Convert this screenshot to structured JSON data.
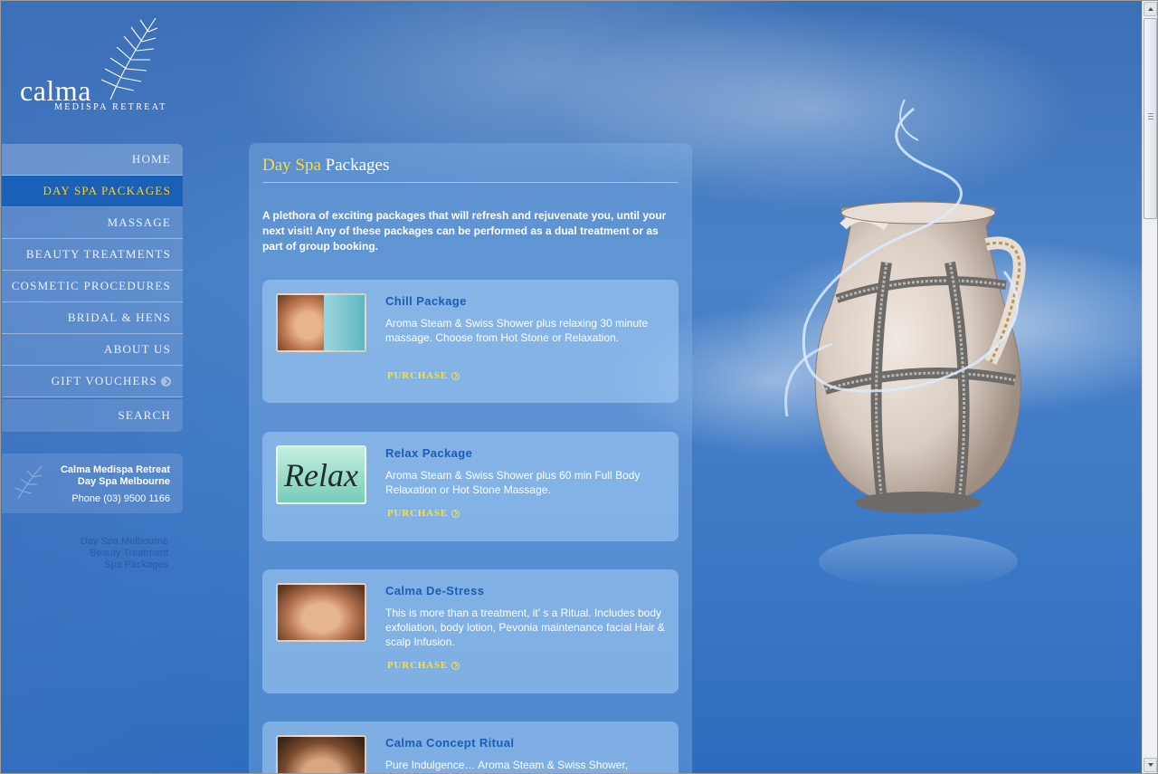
{
  "logo": {
    "word": "calma",
    "subtitle": "MEDISPA RETREAT"
  },
  "nav": {
    "items": [
      {
        "label": "HOME"
      },
      {
        "label": "DAY SPA PACKAGES",
        "active": true
      },
      {
        "label": "MASSAGE"
      },
      {
        "label": "BEAUTY TREATMENTS"
      },
      {
        "label": "COSMETIC PROCEDURES"
      },
      {
        "label": "BRIDAL & HENS"
      },
      {
        "label": "ABOUT US"
      },
      {
        "label": "GIFT VOUCHERS"
      },
      {
        "label": "SEARCH"
      }
    ]
  },
  "contact": {
    "name_line1": "Calma Medispa Retreat",
    "name_line2": "Day Spa Melbourne",
    "phone": "Phone (03) 9500 1166"
  },
  "side_links": [
    "Day Spa Melbourne",
    "Beauty Treatment",
    "Spa Packages"
  ],
  "panel": {
    "title_highlight": "Day Spa",
    "title_rest": "Packages",
    "intro": "A plethora of exciting packages that will refresh and rejuvenate you, until your next visit! Any of these packages can be performed as a dual treatment or as part of group booking."
  },
  "packages": [
    {
      "title": "Chill Package",
      "description": "Aroma Steam & Swiss Shower plus relaxing 30 minute massage. Choose from Hot Stone or Relaxation.",
      "purchase": "PURCHASE"
    },
    {
      "title": "Relax Package",
      "description": "Aroma Steam & Swiss Shower plus 60 min Full Body Relaxation or Hot Stone Massage.",
      "purchase": "PURCHASE",
      "thumb_text": "Relax"
    },
    {
      "title": "Calma De-Stress",
      "description": "This is more than a treatment, it’ s a Ritual. Includes body exfoliation, body lotion, Pevonia maintenance facial Hair & scalp Infusion.",
      "purchase": "PURCHASE"
    },
    {
      "title": "Calma Concept Ritual",
      "description": "Pure Indulgence… Aroma Steam & Swiss Shower,"
    }
  ],
  "colors": {
    "accent_yellow": "#ffd21a",
    "active_nav": "#1a5fb8",
    "package_title": "#1b5db4"
  }
}
